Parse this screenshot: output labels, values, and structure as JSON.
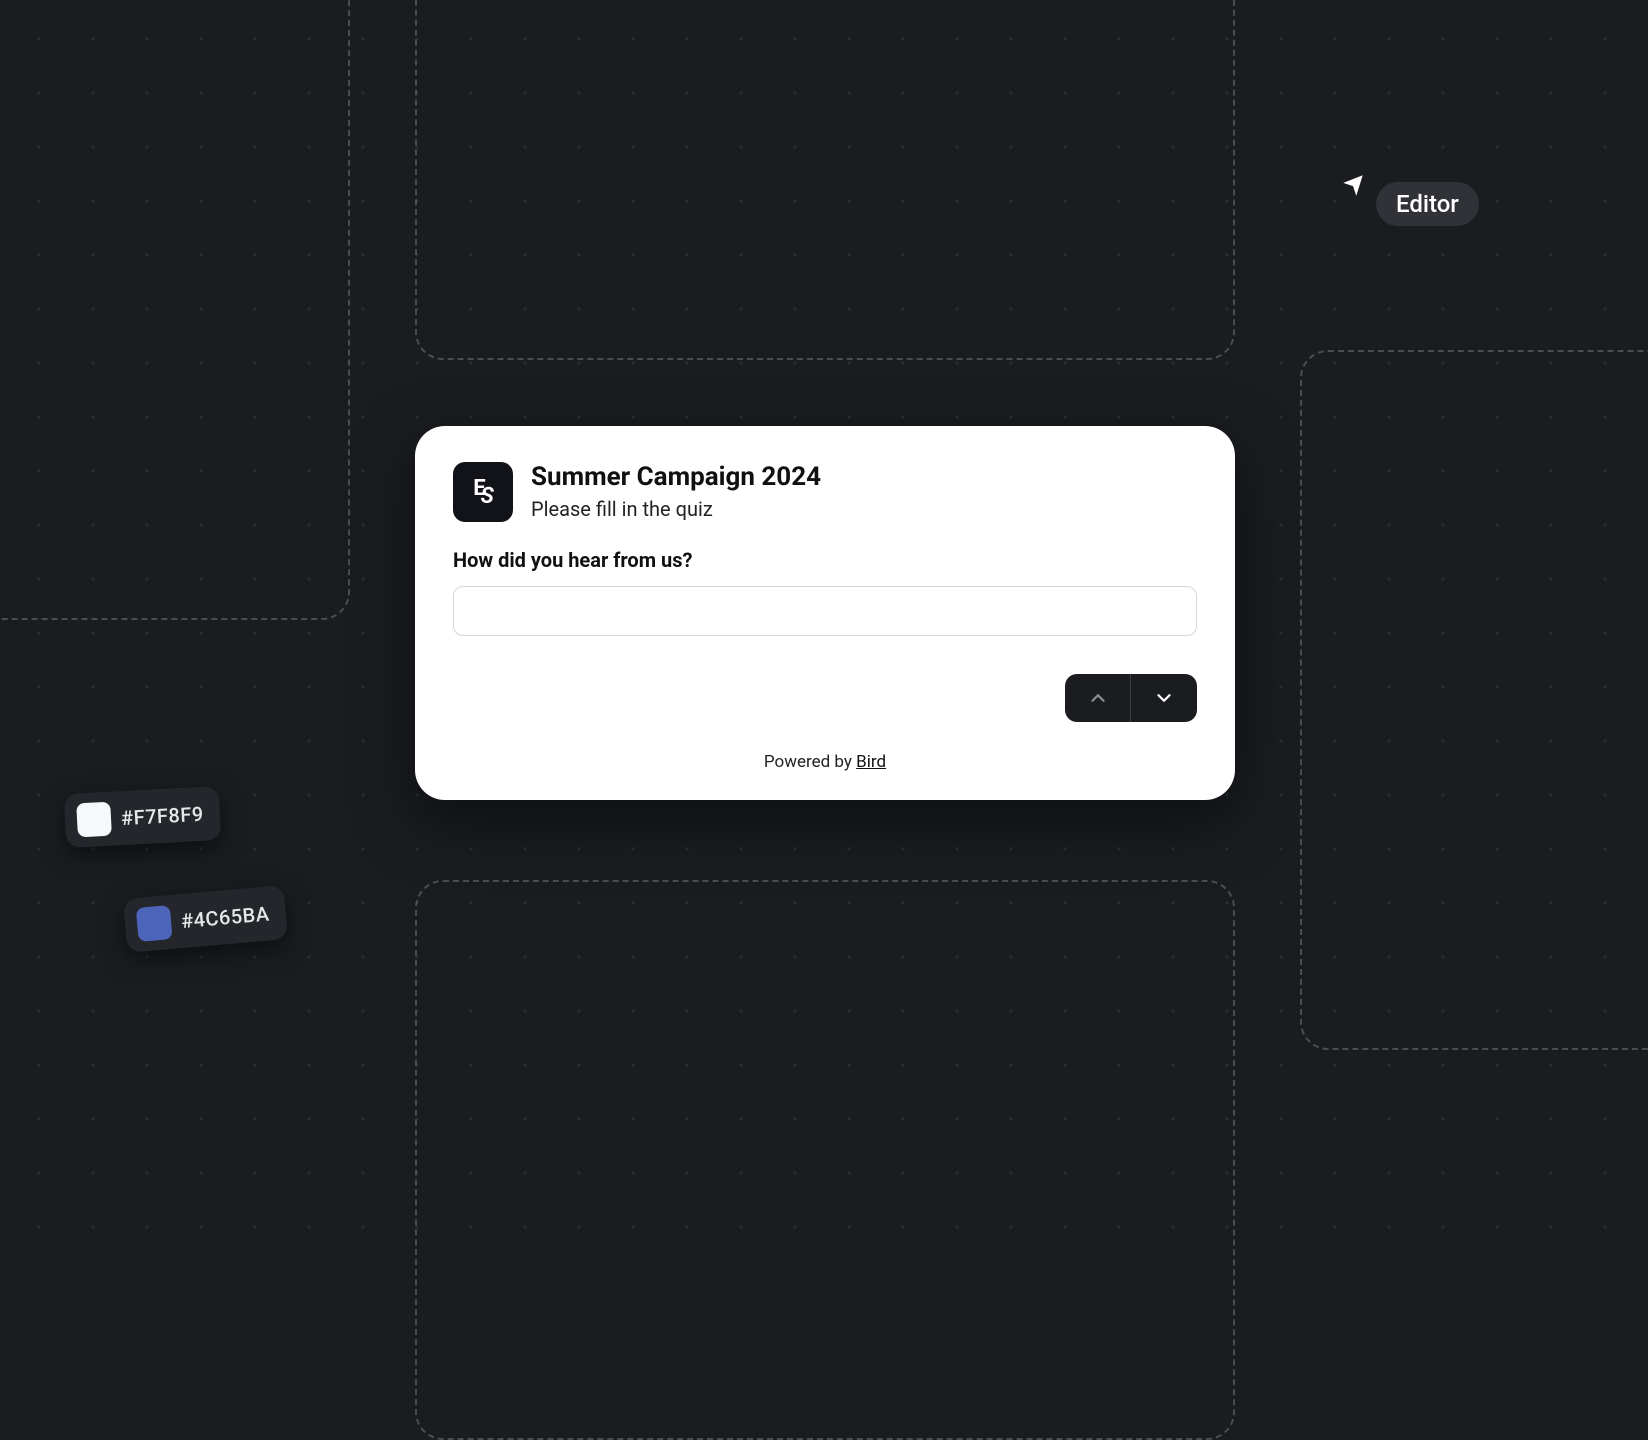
{
  "cursor": {
    "label": "Editor"
  },
  "chips": [
    {
      "hex": "#F7F8F9",
      "swatch": "#F7F8F9"
    },
    {
      "hex": "#4C65BA",
      "swatch": "#4C65BA"
    }
  ],
  "card": {
    "logo_text_1": "E",
    "logo_text_2": "S",
    "title": "Summer Campaign 2024",
    "subtitle": "Please fill in the quiz",
    "question": "How did you hear from us?",
    "input_value": "",
    "footer_prefix": "Powered by ",
    "footer_link": "Bird"
  }
}
